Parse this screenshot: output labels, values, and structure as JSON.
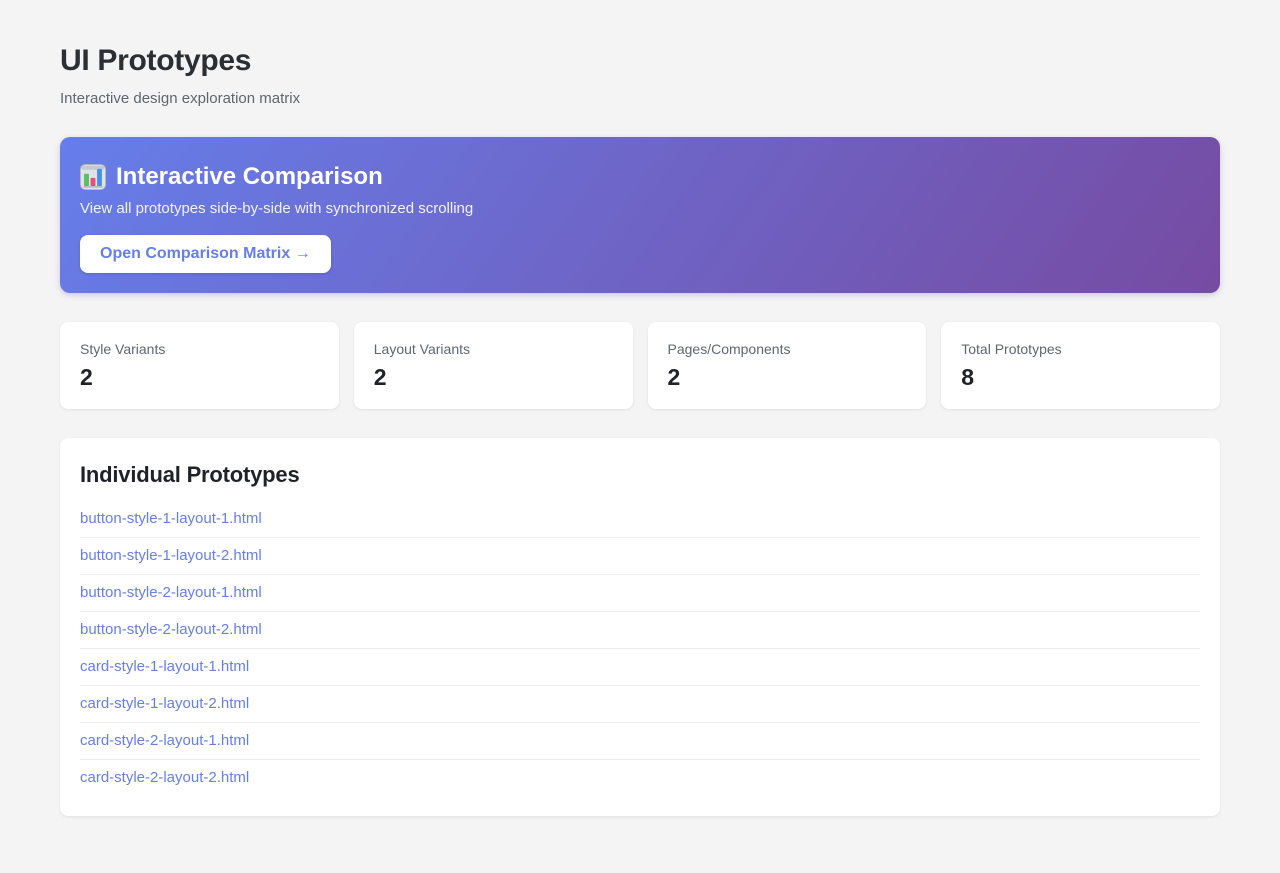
{
  "page": {
    "title": "UI Prototypes",
    "subtitle": "Interactive design exploration matrix"
  },
  "banner": {
    "icon": "bar-chart-emoji",
    "title": "Interactive Comparison",
    "description": "View all prototypes side-by-side with synchronized scrolling",
    "button_label": "Open Comparison Matrix →",
    "gradient_start": "#667eea",
    "gradient_end": "#764ba2",
    "button_text_color": "#667eea"
  },
  "stats": [
    {
      "label": "Style Variants",
      "value": "2"
    },
    {
      "label": "Layout Variants",
      "value": "2"
    },
    {
      "label": "Pages/Components",
      "value": "2"
    },
    {
      "label": "Total Prototypes",
      "value": "8"
    }
  ],
  "prototypes": {
    "heading": "Individual Prototypes",
    "link_color": "#667eea",
    "links": [
      "button-style-1-layout-1.html",
      "button-style-1-layout-2.html",
      "button-style-2-layout-1.html",
      "button-style-2-layout-2.html",
      "card-style-1-layout-1.html",
      "card-style-1-layout-2.html",
      "card-style-2-layout-1.html",
      "card-style-2-layout-2.html"
    ]
  }
}
